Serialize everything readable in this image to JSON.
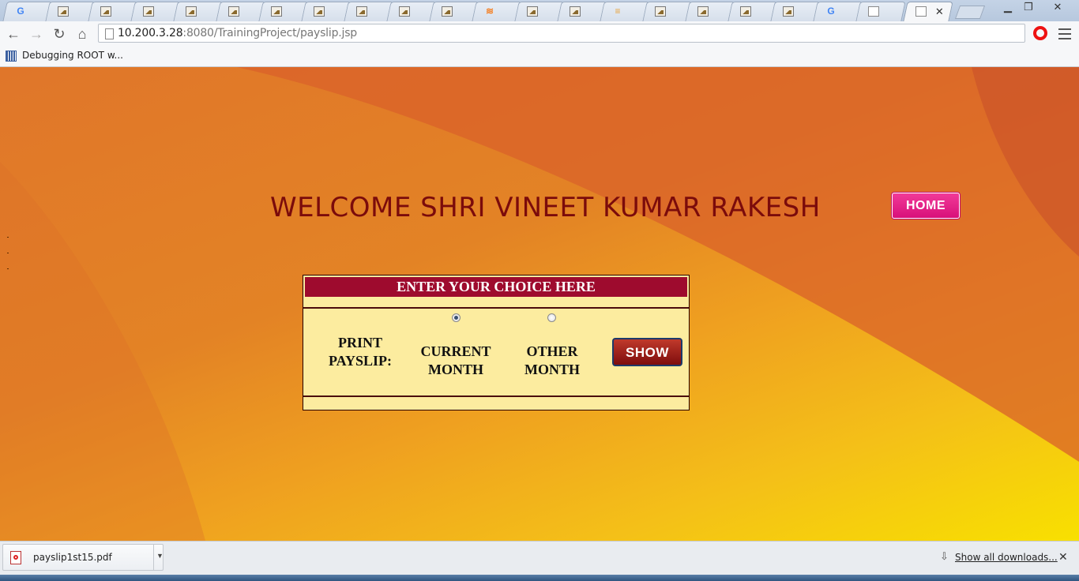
{
  "browser": {
    "tabs": [
      {
        "icon": "google-icon"
      },
      {
        "icon": "image-icon"
      },
      {
        "icon": "image-icon"
      },
      {
        "icon": "image-icon"
      },
      {
        "icon": "image-icon"
      },
      {
        "icon": "image-icon"
      },
      {
        "icon": "image-icon"
      },
      {
        "icon": "image-icon"
      },
      {
        "icon": "image-icon"
      },
      {
        "icon": "image-icon"
      },
      {
        "icon": "image-icon"
      },
      {
        "icon": "stackoverflow-icon"
      },
      {
        "icon": "image-icon"
      },
      {
        "icon": "image-icon"
      },
      {
        "icon": "menu-icon"
      },
      {
        "icon": "image-icon"
      },
      {
        "icon": "image-icon"
      },
      {
        "icon": "image-icon"
      },
      {
        "icon": "image-icon"
      },
      {
        "icon": "google-icon"
      },
      {
        "icon": "document-icon"
      },
      {
        "icon": "document-icon",
        "active": true
      }
    ],
    "address": {
      "host": "10.200.3.28",
      "rest": ":8080/TrainingProject/payslip.jsp"
    },
    "bookmark": {
      "label": "Debugging ROOT w..."
    }
  },
  "page": {
    "welcome": "WELCOME SHRI VINEET KUMAR RAKESH",
    "home_label": "HOME",
    "choice": {
      "header": "ENTER YOUR CHOICE HERE",
      "print_label": "PRINT PAYSLIP:",
      "current_label": "CURRENT MONTH",
      "other_label": "OTHER MONTH",
      "selected": "current",
      "show_label": "SHOW"
    }
  },
  "downloads": {
    "file_name": "payslip1st15.pdf",
    "show_all": "Show all downloads..."
  },
  "colors": {
    "welcome_text": "#7b0b0b",
    "header_bg": "#9e0b2e",
    "box_bg": "#fcec9f",
    "home_button": "#e0197f"
  }
}
